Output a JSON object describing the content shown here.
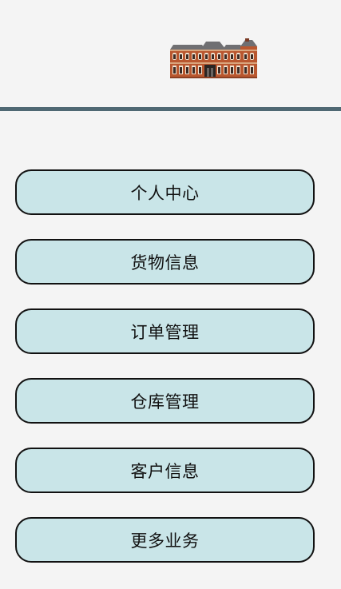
{
  "header": {
    "logo_icon": "building-icon"
  },
  "menu": {
    "items": [
      {
        "label": "个人中心"
      },
      {
        "label": "货物信息"
      },
      {
        "label": "订单管理"
      },
      {
        "label": "仓库管理"
      },
      {
        "label": "客户信息"
      },
      {
        "label": "更多业务"
      }
    ]
  },
  "colors": {
    "background": "#f4f4f4",
    "divider": "#4f6873",
    "button_fill": "#c9e5e8",
    "button_border": "#111111"
  }
}
